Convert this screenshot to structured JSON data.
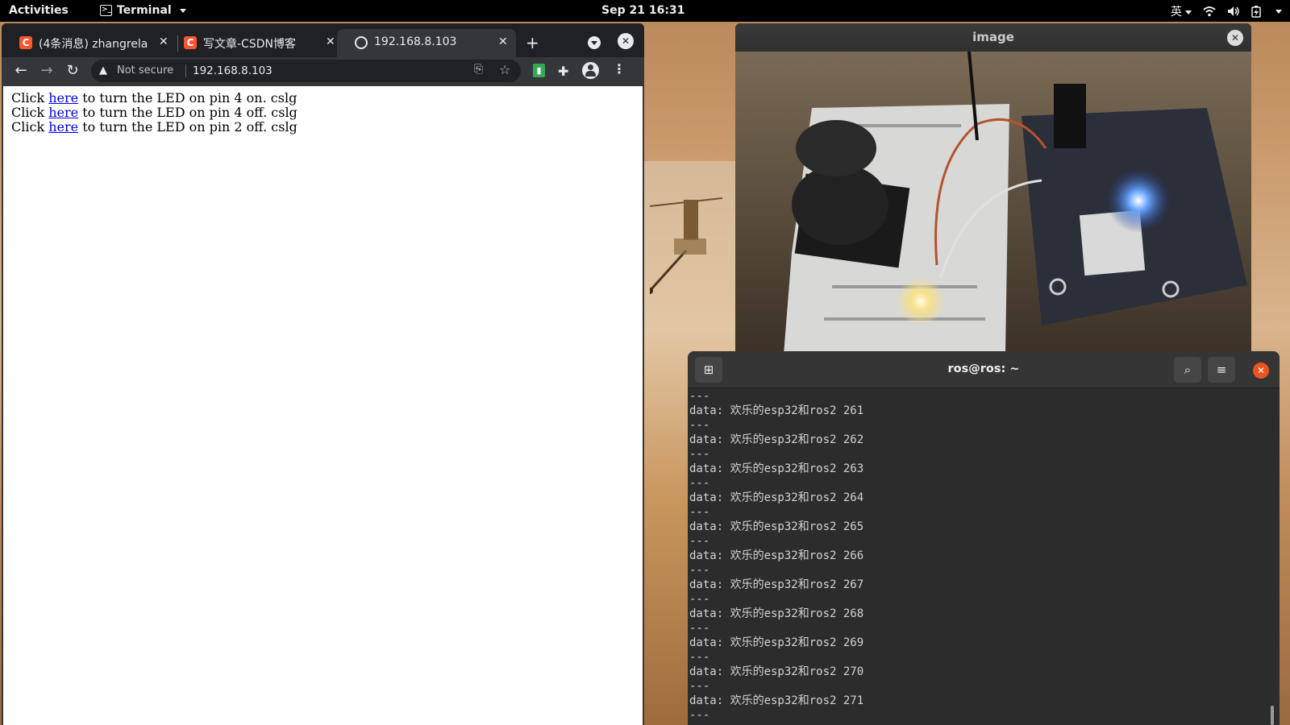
{
  "topbar": {
    "activities": "Activities",
    "app_name": "Terminal",
    "clock": "Sep 21  16:31",
    "input_method": "英"
  },
  "browser": {
    "tabs": [
      {
        "title": "(4条消息) zhangrela",
        "favicon": "C"
      },
      {
        "title": "写文章-CSDN博客",
        "favicon": "C"
      },
      {
        "title": "192.168.8.103",
        "favicon": "globe"
      }
    ],
    "security_label": "Not secure",
    "url": "192.168.8.103",
    "page": {
      "lines": [
        {
          "prefix": "Click ",
          "link": "here",
          "suffix": " to turn the LED on pin 4 on. cslg"
        },
        {
          "prefix": "Click ",
          "link": "here",
          "suffix": " to turn the LED on pin 4 off. cslg"
        },
        {
          "prefix": "Click ",
          "link": "here",
          "suffix": " to turn the LED on pin 2 off. cslg"
        }
      ]
    }
  },
  "image_window": {
    "title": "image"
  },
  "terminal": {
    "title": "ros@ros: ~",
    "lines": [
      "---",
      "data: 欢乐的esp32和ros2 261",
      "---",
      "data: 欢乐的esp32和ros2 262",
      "---",
      "data: 欢乐的esp32和ros2 263",
      "---",
      "data: 欢乐的esp32和ros2 264",
      "---",
      "data: 欢乐的esp32和ros2 265",
      "---",
      "data: 欢乐的esp32和ros2 266",
      "---",
      "data: 欢乐的esp32和ros2 267",
      "---",
      "data: 欢乐的esp32和ros2 268",
      "---",
      "data: 欢乐的esp32和ros2 269",
      "---",
      "data: 欢乐的esp32和ros2 270",
      "---",
      "data: 欢乐的esp32和ros2 271",
      "---"
    ]
  },
  "colors": {
    "terminal_close": "#e95420",
    "csdn_favicon": "#fc5531",
    "link": "#0000ee"
  }
}
